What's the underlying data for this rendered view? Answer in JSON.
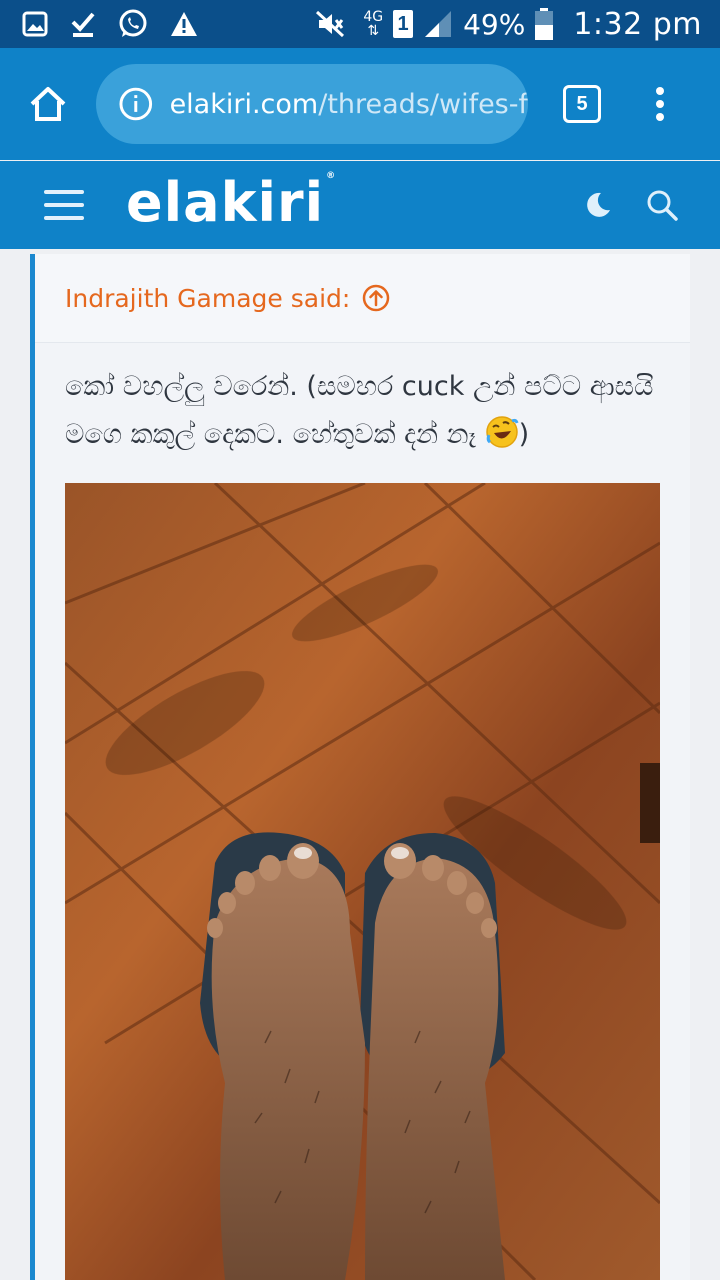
{
  "status_bar": {
    "network_top": "4G",
    "network_bottom": "⇅",
    "sim_slot": "1",
    "battery_percent": "49%",
    "time": "1:32 pm"
  },
  "browser": {
    "url_domain": "elakiri.com",
    "url_path": "/threads/wifes-f",
    "tab_count": "5"
  },
  "site": {
    "logo_text": "elakiri",
    "logo_mark": "®"
  },
  "quote": {
    "author_line": "Indrajith Gamage said:",
    "text_part1": "කෝ වහල්ලු වරෙන්. (සමහර cuck උන් පට්ට ආසයි මගෙ කකුල් දෙකට. හේතුවක් දන් නෑ ",
    "text_part2": ")",
    "emoji": "rolling-on-floor-laughing"
  },
  "photo": {
    "subject": "feet-on-sandals-wooden-floor"
  },
  "colors": {
    "status_bar": "#0b4f8a",
    "browser_bar": "#0f82c8",
    "url_box": "#3aa1da",
    "quote_author": "#e5681e",
    "quote_bar": "#1b88cf"
  }
}
